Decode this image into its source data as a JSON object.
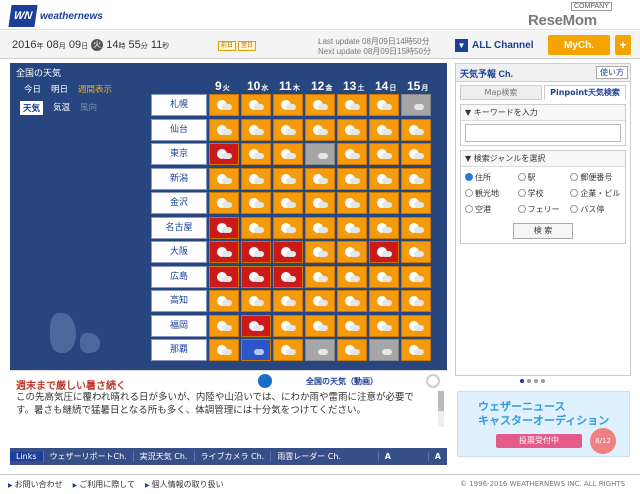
{
  "company": "COMPANY",
  "watermark": "ReseMom",
  "header": {
    "logo_mark": "WN",
    "logo_text": "weathernews"
  },
  "datebar": {
    "year": "2016",
    "month": "08",
    "day": "09",
    "dow": "火",
    "hour": "14",
    "min": "55",
    "sec": "11",
    "btn1": "前日",
    "btn2": "翌日",
    "last_update": "Last update  08月09日14時50分",
    "next_update": "Next update  08月09日15時50分"
  },
  "channel": {
    "all_label": "ALL Channel",
    "mych_label": "MyCh.",
    "plus": "+"
  },
  "map": {
    "title": "全国の天気",
    "mode_today": "今日",
    "mode_tomorrow": "明日",
    "mode_week": "週間表示",
    "tab_weather": "天気",
    "tab_temp": "気温",
    "tab_wind": "風向",
    "days": [
      {
        "d": "9",
        "w": "火"
      },
      {
        "d": "10",
        "w": "水"
      },
      {
        "d": "11",
        "w": "木"
      },
      {
        "d": "12",
        "w": "金"
      },
      {
        "d": "13",
        "w": "土"
      },
      {
        "d": "14",
        "w": "日"
      },
      {
        "d": "15",
        "w": "月"
      }
    ],
    "cities": [
      "札幌",
      "仙台",
      "東京",
      "新潟",
      "金沢",
      "名古屋",
      "大阪",
      "広島",
      "高知",
      "福岡",
      "那覇"
    ],
    "grid": [
      [
        "sun",
        "sun",
        "sun",
        "sun",
        "sun",
        "sun",
        "cld"
      ],
      [
        "sun",
        "sun",
        "sun",
        "sun",
        "sun",
        "sun",
        "sun"
      ],
      [
        "hot",
        "sun",
        "sun",
        "cld",
        "sun",
        "sun",
        "sun"
      ],
      [
        "sun",
        "sun",
        "sun",
        "sun",
        "sun",
        "sun",
        "sun"
      ],
      [
        "sun",
        "sun",
        "sun",
        "sun",
        "sun",
        "sun",
        "sun"
      ],
      [
        "hot",
        "sun",
        "sun",
        "sun",
        "sun",
        "sun",
        "sun"
      ],
      [
        "hot",
        "hot",
        "hot",
        "sun",
        "sun",
        "hot",
        "sun"
      ],
      [
        "hot",
        "hot",
        "hot",
        "sun",
        "sun",
        "sun",
        "sun"
      ],
      [
        "sun",
        "sun",
        "sun",
        "sun",
        "sun",
        "sun",
        "sun"
      ],
      [
        "sun",
        "hot",
        "sun",
        "sun",
        "sun",
        "sun",
        "sun"
      ],
      [
        "sun",
        "rain",
        "sun",
        "cld",
        "sun",
        "cld",
        "sun"
      ]
    ]
  },
  "news": {
    "headline": "週末まで厳しい暑さ続く",
    "body": "この先高気圧に覆われ晴れる日が多いが、内陸や山沿いでは、にわか雨や雷雨に注意が必要です。暑さも継続で猛暑日となる所も多く、体調管理には十分気をつけてください。",
    "video_label": "全国の天気（動画）"
  },
  "links": {
    "label": "Links",
    "items": [
      "ウェザーリポートCh.",
      "実況天気 Ch.",
      "ライブカメラ Ch.",
      "雨雲レーダー Ch."
    ],
    "font_a": "A",
    "font_b": "A"
  },
  "right": {
    "title": "天気予報 Ch.",
    "tip": "使い方",
    "tab_map": "Map検索",
    "tab_pinpoint": "Pinpoint天気検索",
    "kw_label": "▼ キーワードを入力",
    "genre_label": "▼ 検索ジャンルを選択",
    "options": [
      "住所",
      "駅",
      "郵便番号",
      "観光地",
      "学校",
      "企業・ビル",
      "空港",
      "フェリー",
      "バス停"
    ],
    "search_btn": "検 索"
  },
  "ad": {
    "line1": "ウェザーニュース",
    "line2": "キャスターオーディション",
    "btn": "投票受付中",
    "badge": "8/12"
  },
  "footer": {
    "links": [
      "お問い合わせ",
      "ご利用に際して",
      "個人情報の取り扱い"
    ],
    "copyright": "© 1996-2016 WEATHERNEWS INC. ALL RIGHTS"
  }
}
